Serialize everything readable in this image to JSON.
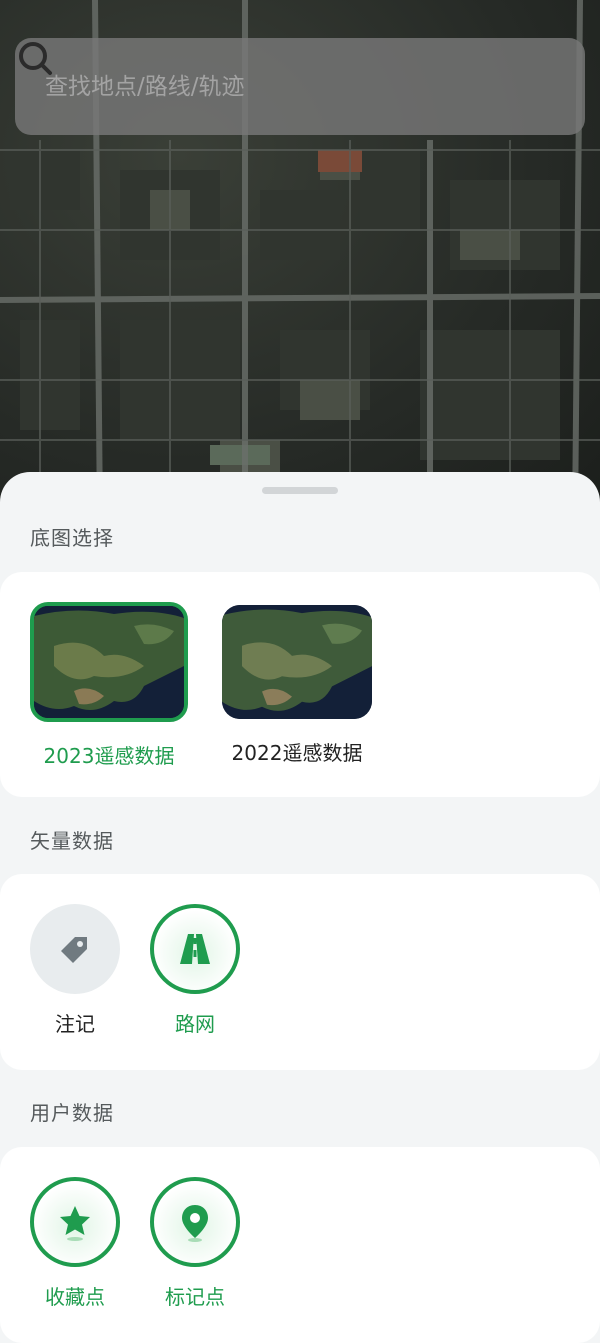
{
  "search": {
    "placeholder": "查找地点/路线/轨迹"
  },
  "basemap_section": {
    "title": "底图选择",
    "items": [
      {
        "label": "2023遥感数据",
        "selected": true
      },
      {
        "label": "2022遥感数据",
        "selected": false
      }
    ]
  },
  "vector_section": {
    "title": "矢量数据",
    "items": [
      {
        "label": "注记",
        "icon": "tag-icon",
        "active": false
      },
      {
        "label": "路网",
        "icon": "road-icon",
        "active": true
      }
    ]
  },
  "user_section": {
    "title": "用户数据",
    "items": [
      {
        "label": "收藏点",
        "icon": "star-pin-icon",
        "active": true
      },
      {
        "label": "标记点",
        "icon": "location-pin-icon",
        "active": true
      }
    ]
  },
  "colors": {
    "accent": "#1f9c4e",
    "sheet_bg": "#f3f5f6",
    "inactive_circle": "#e8ecee"
  }
}
